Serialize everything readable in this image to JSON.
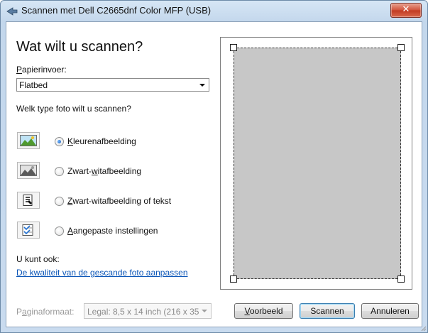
{
  "window": {
    "title": "Scannen met Dell C2665dnf Color MFP (USB)",
    "close_label": "✕"
  },
  "main": {
    "heading": "Wat wilt u scannen?",
    "paper_feed_label_accel": "P",
    "paper_feed_label_rest": "apierinvoer:",
    "paper_feed_value": "Flatbed",
    "photo_type_question": "Welk type foto wilt u scannen?",
    "options": [
      {
        "accel": "K",
        "rest": "leurenafbeelding",
        "selected": true,
        "icon": "color-photo-icon"
      },
      {
        "pre": "Zwart-",
        "accel": "w",
        "rest": "itafbeelding",
        "selected": false,
        "icon": "grayscale-photo-icon"
      },
      {
        "accel": "Z",
        "rest": "wart-witafbeelding of tekst",
        "selected": false,
        "icon": "bw-text-icon"
      },
      {
        "accel": "A",
        "rest": "angepaste instellingen",
        "selected": false,
        "icon": "custom-settings-icon"
      }
    ],
    "also_label": "U kunt ook:",
    "adjust_link": "De kwaliteit van de gescande foto aanpassen"
  },
  "footer": {
    "paper_size_label_pre": "P",
    "paper_size_label_accel": "a",
    "paper_size_label_rest": "ginaformaat:",
    "paper_size_value": "Legal: 8,5 x 14 inch (216 x 35",
    "preview_accel": "V",
    "preview_rest": "oorbeeld",
    "scan_label": "Scannen",
    "cancel_label": "Annuleren"
  },
  "colors": {
    "link": "#0a55b7",
    "scan_area": "#c7c7c7",
    "close_button": "#c13a22"
  }
}
